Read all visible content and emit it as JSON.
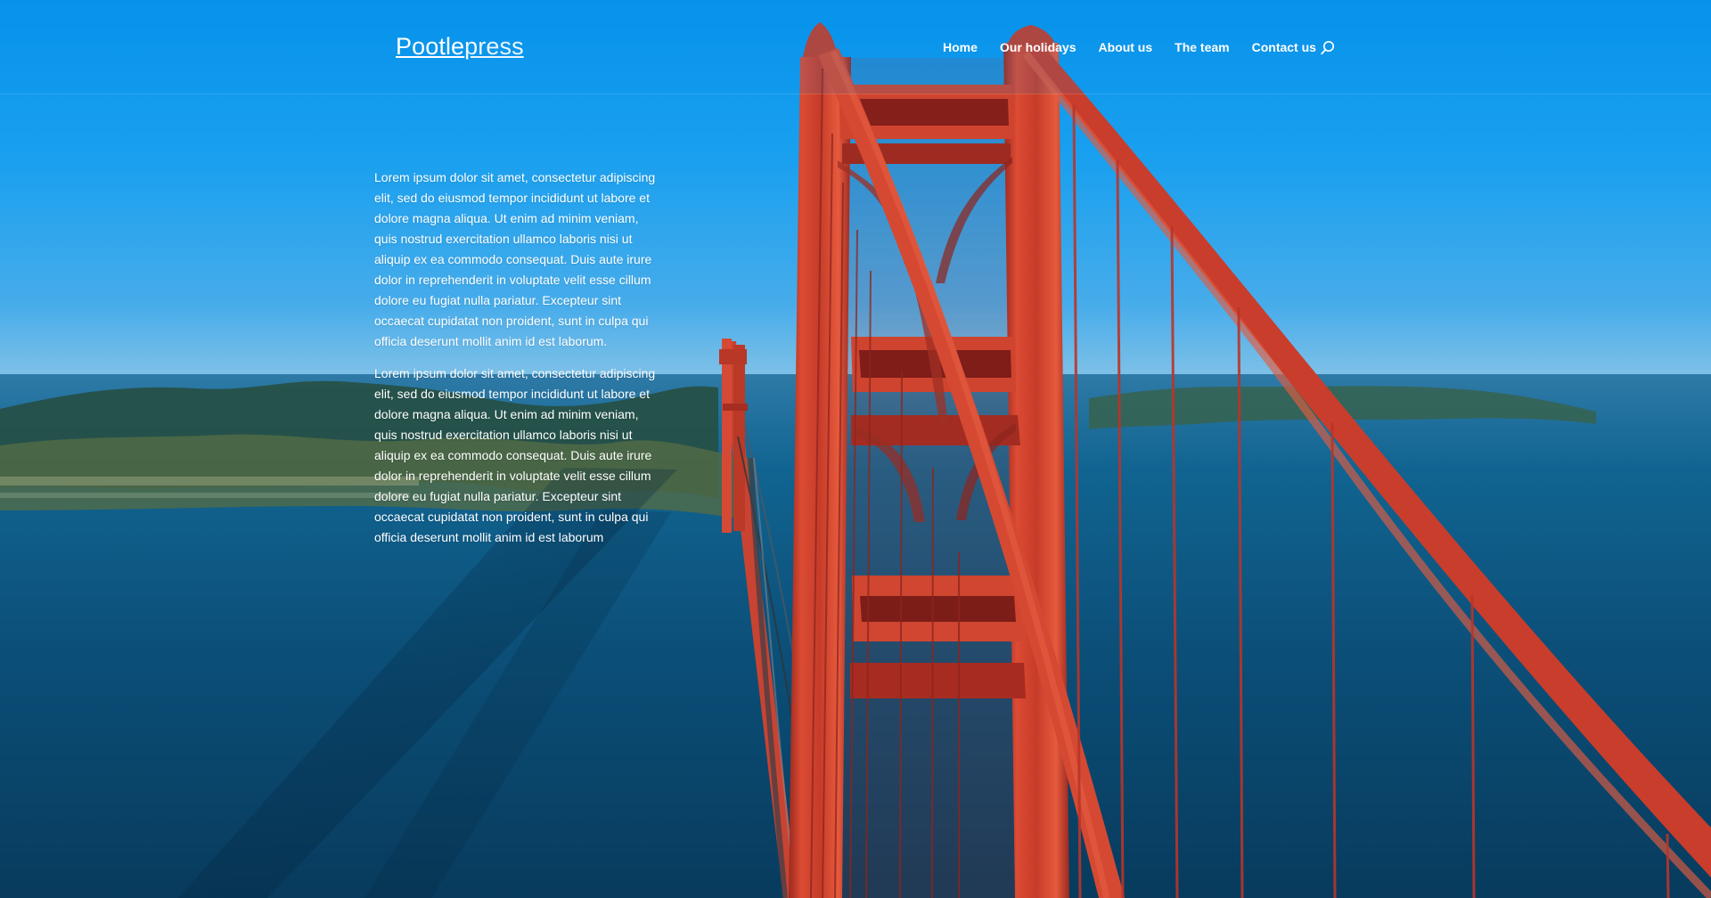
{
  "site": {
    "logo": {
      "strong": "Pootle",
      "light": "press"
    }
  },
  "header": {
    "nav": [
      {
        "label": "Home"
      },
      {
        "label": "Our holidays"
      },
      {
        "label": "About us"
      },
      {
        "label": "The team"
      },
      {
        "label": "Contact us"
      }
    ],
    "search_icon": "search-icon"
  },
  "main": {
    "paragraphs": [
      "Lorem ipsum dolor sit amet, consectetur adipiscing elit, sed do eiusmod tempor incididunt ut labore et dolore magna aliqua. Ut enim ad minim veniam, quis nostrud exercitation ullamco laboris nisi ut aliquip ex ea commodo consequat. Duis aute irure dolor in reprehenderit in voluptate velit esse cillum dolore eu fugiat nulla pariatur. Excepteur sint occaecat cupidatat non proident, sunt in culpa qui officia deserunt mollit anim id est laborum.",
      "Lorem ipsum dolor sit amet, consectetur adipiscing elit, sed do eiusmod tempor incididunt ut labore et dolore magna aliqua. Ut enim ad minim veniam, quis nostrud exercitation ullamco laboris nisi ut aliquip ex ea commodo consequat. Duis aute irure dolor in reprehenderit in voluptate velit esse cillum dolore eu fugiat nulla pariatur. Excepteur sint occaecat cupidatat non proident, sunt in culpa qui officia deserunt mollit anim id est laborum"
    ]
  },
  "colors": {
    "header_text": "#ffffff",
    "sky_top": "#0896ee",
    "water": "#0e4f77",
    "bridge": "#d84632"
  }
}
